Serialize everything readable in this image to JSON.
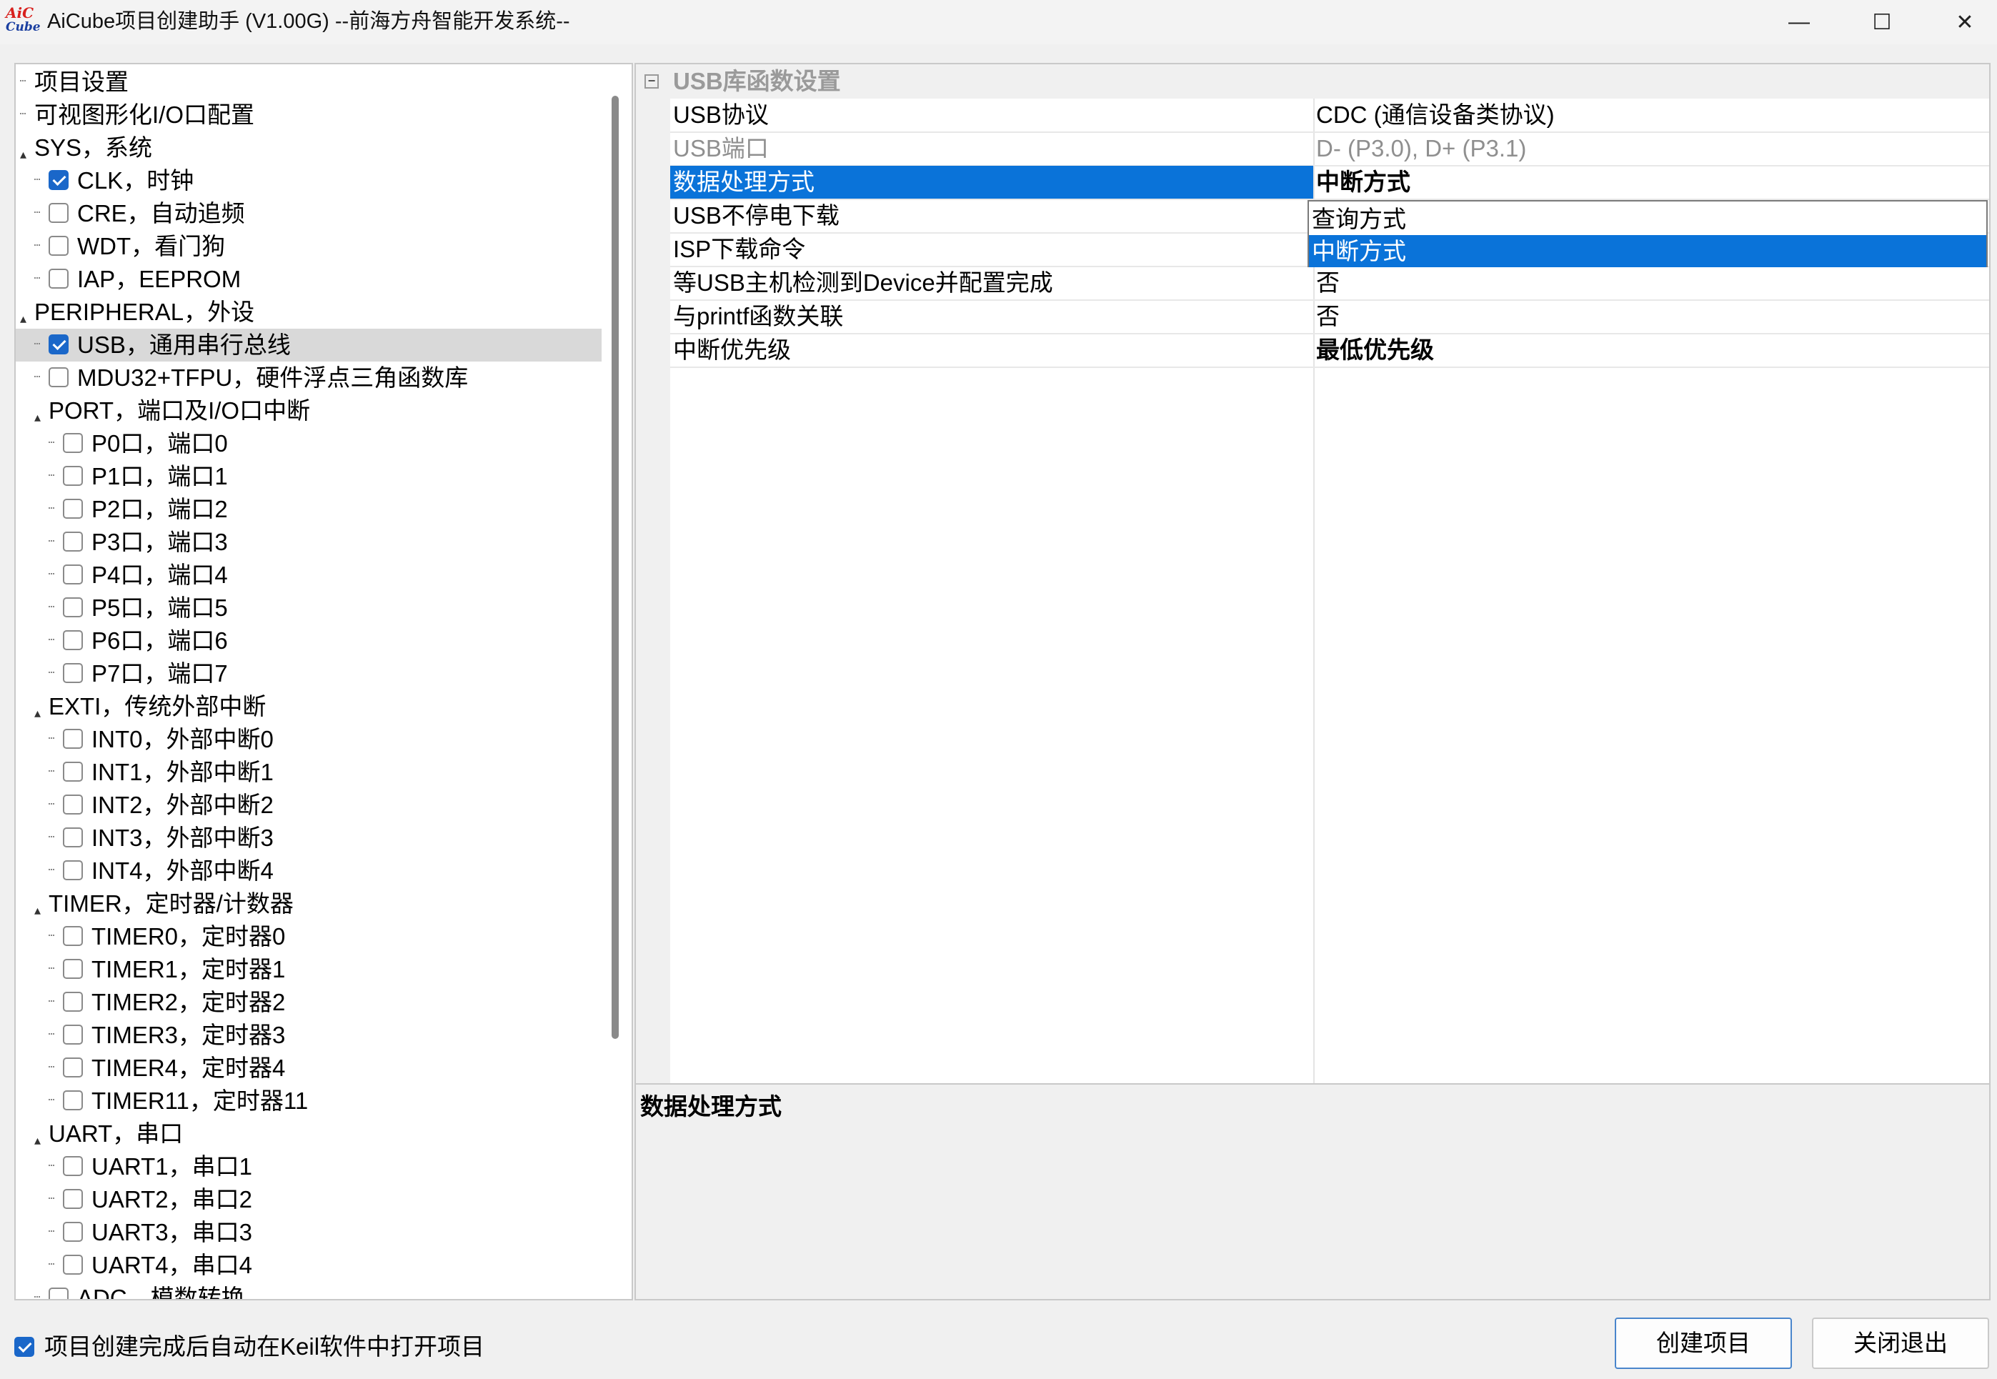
{
  "window": {
    "title": "AiCube项目创建助手 (V1.00G) --前海方舟智能开发系统--",
    "logo_line1": "AiC",
    "logo_line2": "Cube",
    "minimize_glyph": "—",
    "maximize_glyph": "☐",
    "close_glyph": "✕"
  },
  "tree": [
    {
      "label": "项目设置",
      "indent": 0,
      "type": "leaf"
    },
    {
      "label": "可视图形化I/O口配置",
      "indent": 0,
      "type": "leaf"
    },
    {
      "label": "SYS，系统",
      "indent": 0,
      "type": "group"
    },
    {
      "label": "CLK，时钟",
      "indent": 1,
      "type": "check",
      "checked": true
    },
    {
      "label": "CRE，自动追频",
      "indent": 1,
      "type": "check",
      "checked": false
    },
    {
      "label": "WDT，看门狗",
      "indent": 1,
      "type": "check",
      "checked": false
    },
    {
      "label": "IAP，EEPROM",
      "indent": 1,
      "type": "check",
      "checked": false
    },
    {
      "label": "PERIPHERAL，外设",
      "indent": 0,
      "type": "group"
    },
    {
      "label": "USB，通用串行总线",
      "indent": 1,
      "type": "check",
      "checked": true,
      "selected": true
    },
    {
      "label": "MDU32+TFPU，硬件浮点三角函数库",
      "indent": 1,
      "type": "check",
      "checked": false
    },
    {
      "label": "PORT，端口及I/O口中断",
      "indent": 1,
      "type": "group"
    },
    {
      "label": "P0口，端口0",
      "indent": 2,
      "type": "check",
      "checked": false
    },
    {
      "label": "P1口，端口1",
      "indent": 2,
      "type": "check",
      "checked": false
    },
    {
      "label": "P2口，端口2",
      "indent": 2,
      "type": "check",
      "checked": false
    },
    {
      "label": "P3口，端口3",
      "indent": 2,
      "type": "check",
      "checked": false
    },
    {
      "label": "P4口，端口4",
      "indent": 2,
      "type": "check",
      "checked": false
    },
    {
      "label": "P5口，端口5",
      "indent": 2,
      "type": "check",
      "checked": false
    },
    {
      "label": "P6口，端口6",
      "indent": 2,
      "type": "check",
      "checked": false
    },
    {
      "label": "P7口，端口7",
      "indent": 2,
      "type": "check",
      "checked": false
    },
    {
      "label": "EXTI，传统外部中断",
      "indent": 1,
      "type": "group"
    },
    {
      "label": "INT0，外部中断0",
      "indent": 2,
      "type": "check",
      "checked": false
    },
    {
      "label": "INT1，外部中断1",
      "indent": 2,
      "type": "check",
      "checked": false
    },
    {
      "label": "INT2，外部中断2",
      "indent": 2,
      "type": "check",
      "checked": false
    },
    {
      "label": "INT3，外部中断3",
      "indent": 2,
      "type": "check",
      "checked": false
    },
    {
      "label": "INT4，外部中断4",
      "indent": 2,
      "type": "check",
      "checked": false
    },
    {
      "label": "TIMER，定时器/计数器",
      "indent": 1,
      "type": "group"
    },
    {
      "label": "TIMER0，定时器0",
      "indent": 2,
      "type": "check",
      "checked": false
    },
    {
      "label": "TIMER1，定时器1",
      "indent": 2,
      "type": "check",
      "checked": false
    },
    {
      "label": "TIMER2，定时器2",
      "indent": 2,
      "type": "check",
      "checked": false
    },
    {
      "label": "TIMER3，定时器3",
      "indent": 2,
      "type": "check",
      "checked": false
    },
    {
      "label": "TIMER4，定时器4",
      "indent": 2,
      "type": "check",
      "checked": false
    },
    {
      "label": "TIMER11，定时器11",
      "indent": 2,
      "type": "check",
      "checked": false
    },
    {
      "label": "UART，串口",
      "indent": 1,
      "type": "group"
    },
    {
      "label": "UART1，串口1",
      "indent": 2,
      "type": "check",
      "checked": false
    },
    {
      "label": "UART2，串口2",
      "indent": 2,
      "type": "check",
      "checked": false
    },
    {
      "label": "UART3，串口3",
      "indent": 2,
      "type": "check",
      "checked": false
    },
    {
      "label": "UART4，串口4",
      "indent": 2,
      "type": "check",
      "checked": false
    },
    {
      "label": "ADC，模数转换",
      "indent": 1,
      "type": "check",
      "checked": false
    }
  ],
  "properties": {
    "category": "USB库函数设置",
    "category_toggle": "−",
    "rows": [
      {
        "name": "USB协议",
        "value": "CDC (通信设备类协议)"
      },
      {
        "name": "USB端口",
        "value": "D- (P3.0), D+ (P3.1)",
        "disabled": true
      },
      {
        "name": "数据处理方式",
        "value": "中断方式",
        "bold": true,
        "selected": true,
        "dropdown": true
      },
      {
        "name": "USB不停电下载",
        "value": ""
      },
      {
        "name": "ISP下载命令",
        "value": ""
      },
      {
        "name": "等USB主机检测到Device并配置完成",
        "value": "否"
      },
      {
        "name": "与printf函数关联",
        "value": "否"
      },
      {
        "name": "中断优先级",
        "value": "最低优先级",
        "bold": true
      }
    ],
    "dropdown_button_glyph": "⌄",
    "dropdown_options": [
      {
        "label": "查询方式",
        "highlighted": false
      },
      {
        "label": "中断方式",
        "highlighted": true
      }
    ]
  },
  "description": {
    "title": "数据处理方式"
  },
  "footer": {
    "auto_open_label": "项目创建完成后自动在Keil软件中打开项目",
    "auto_open_checked": true,
    "create_button": "创建项目",
    "exit_button": "关闭退出"
  },
  "colors": {
    "selection_blue": "#0a73d9",
    "checkbox_blue": "#1a67c9",
    "logo_red": "#d8201d",
    "logo_blue": "#1b3fa0"
  }
}
